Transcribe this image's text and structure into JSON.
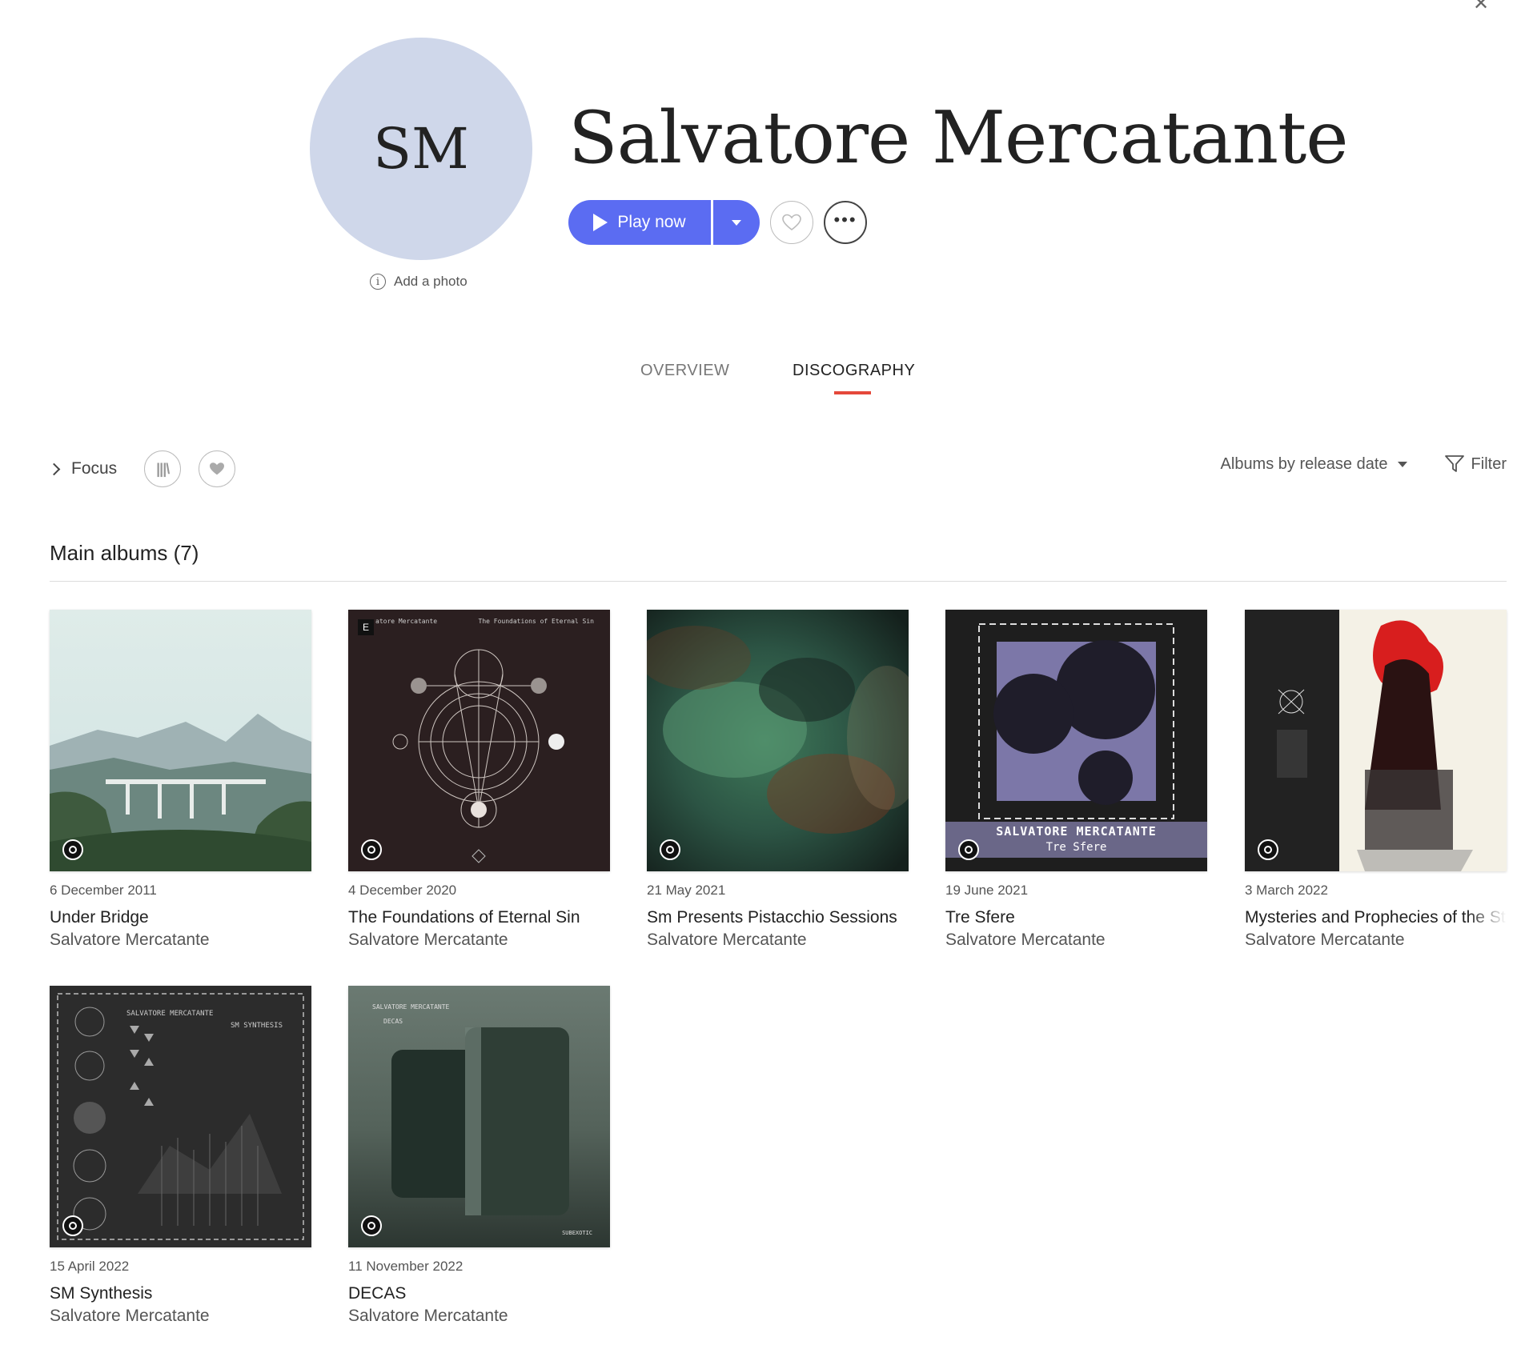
{
  "window": {
    "close_glyph": "✕"
  },
  "artist": {
    "initials": "SM",
    "name": "Salvatore Mercatante",
    "add_photo_label": "Add a photo",
    "info_glyph": "i"
  },
  "actions": {
    "play_label": "Play now",
    "more_glyph": "•••"
  },
  "tabs": [
    {
      "label": "OVERVIEW",
      "active": false
    },
    {
      "label": "DISCOGRAPHY",
      "active": true
    }
  ],
  "toolbar": {
    "focus_label": "Focus",
    "library_glyph": "|||\\",
    "sort_label": "Albums by release date",
    "filter_label": "Filter"
  },
  "section": {
    "title": "Main albums (7)"
  },
  "albums": [
    {
      "date": "6 December 2011",
      "title": "Under Bridge",
      "artist": "Salvatore Mercatante",
      "hires": true
    },
    {
      "date": "4 December 2020",
      "title": "The Foundations of Eternal Sin",
      "artist": "Salvatore Mercatante",
      "hires": true,
      "explicit": "E",
      "cover_text_left": "atore Mercatante",
      "cover_text_right": "The Foundations of Eternal Sin"
    },
    {
      "date": "21 May 2021",
      "title": "Sm Presents Pistacchio Sessions",
      "artist": "Salvatore Mercatante",
      "hires": true
    },
    {
      "date": "19 June 2021",
      "title": "Tre Sfere",
      "artist": "Salvatore Mercatante",
      "hires": true,
      "cover_text_artist": "SALVATORE MERCATANTE",
      "cover_text_title": "Tre Sfere"
    },
    {
      "date": "3 March 2022",
      "title": "Mysteries and Prophecies of the St",
      "artist": "Salvatore Mercatante",
      "hires": true
    },
    {
      "date": "15 April 2022",
      "title": "SM Synthesis",
      "artist": "Salvatore Mercatante",
      "hires": true,
      "cover_text_artist": "SALVATORE MERCATANTE",
      "cover_text_title": "SM  SYNTHESIS"
    },
    {
      "date": "11 November 2022",
      "title": "DECAS",
      "artist": "Salvatore Mercatante",
      "hires": true,
      "cover_text_artist": "SALVATORE MERCATANTE",
      "cover_text_title": "DECAS",
      "cover_text_label": "SUBEXOTIC"
    }
  ],
  "colors": {
    "accent": "#5b6cf2",
    "tab_indicator": "#e5483b",
    "avatar_bg": "#cfd7ea"
  }
}
